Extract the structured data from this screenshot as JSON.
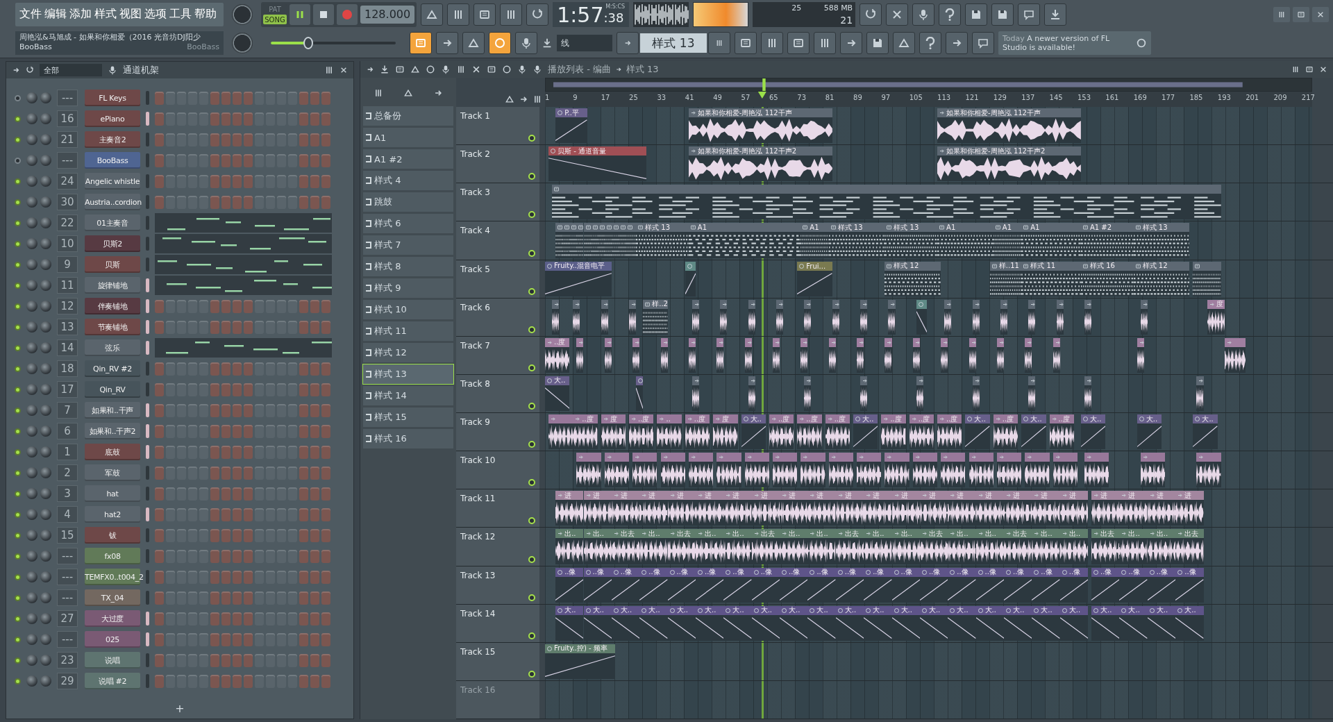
{
  "menu": [
    "文件",
    "编辑",
    "添加",
    "样式",
    "视图",
    "选项",
    "工具",
    "帮助"
  ],
  "hint": {
    "title": "周艳泓&马旭成 - 如果和你相爱（2016 光音坊DJ阳少",
    "line": "BooBass",
    "right": "BooBass"
  },
  "transport": {
    "modes": [
      {
        "label": "PAT",
        "selected": false
      },
      {
        "label": "SONG",
        "selected": true
      }
    ],
    "tempo": "128.000"
  },
  "time": {
    "main": "1:57",
    "cs": ":38",
    "unit": "M:S:CS"
  },
  "cpu": {
    "value": "25",
    "memory": "588 MB",
    "polyphony": "21"
  },
  "master_slider": {
    "level": 0.3
  },
  "tool_buttons": [
    {
      "on": true
    },
    {
      "on": false
    },
    {
      "on": false
    },
    {
      "on": true
    },
    {
      "on": false
    }
  ],
  "snap": "线",
  "pattern_selector": "样式 13",
  "news": {
    "when": "Today",
    "text": "A newer version of FL Studio is available!"
  },
  "channel_rack": {
    "filter": "全部",
    "title": "通道机架",
    "add": "+",
    "channels": [
      {
        "on": false,
        "route": "---",
        "name": "FL Keys",
        "color": "#6e4848",
        "selected": false,
        "kind": "steps"
      },
      {
        "on": true,
        "route": "16",
        "name": "ePiano",
        "color": "#6e4848",
        "selected": true,
        "kind": "steps"
      },
      {
        "on": true,
        "route": "21",
        "name": "主奏音2",
        "color": "#6e4848",
        "selected": false,
        "kind": "steps"
      },
      {
        "on": false,
        "route": "---",
        "name": "BooBass",
        "color": "#4f6592",
        "selected": false,
        "kind": "steps"
      },
      {
        "on": true,
        "route": "24",
        "name": "Angelic whistle",
        "color": "#5a646c",
        "selected": false,
        "kind": "steps"
      },
      {
        "on": true,
        "route": "30",
        "name": "Austria..cordion",
        "color": "#5a646c",
        "selected": false,
        "kind": "steps"
      },
      {
        "on": true,
        "route": "22",
        "name": "01主奏音",
        "color": "#5a646c",
        "selected": false,
        "kind": "pianoroll"
      },
      {
        "on": true,
        "route": "10",
        "name": "贝斯2",
        "color": "#573a42",
        "selected": false,
        "kind": "pianoroll"
      },
      {
        "on": true,
        "route": "9",
        "name": "贝斯",
        "color": "#6e4848",
        "selected": false,
        "kind": "pianoroll"
      },
      {
        "on": true,
        "route": "11",
        "name": "旋律铺地",
        "color": "#5a646c",
        "selected": true,
        "kind": "pianoroll"
      },
      {
        "on": true,
        "route": "12",
        "name": "伴奏铺地",
        "color": "#573a42",
        "selected": true,
        "kind": "steps"
      },
      {
        "on": true,
        "route": "13",
        "name": "节奏铺地",
        "color": "#6e4848",
        "selected": true,
        "kind": "steps"
      },
      {
        "on": true,
        "route": "14",
        "name": "弦乐",
        "color": "#5a646c",
        "selected": true,
        "kind": "pianoroll"
      },
      {
        "on": true,
        "route": "18",
        "name": "Qin_RV #2",
        "color": "#47545b",
        "selected": false,
        "kind": "steps"
      },
      {
        "on": true,
        "route": "17",
        "name": "Qin_RV",
        "color": "#47545b",
        "selected": false,
        "kind": "steps"
      },
      {
        "on": true,
        "route": "7",
        "name": "如果和..干声",
        "color": "#5a646c",
        "selected": true,
        "kind": "steps"
      },
      {
        "on": true,
        "route": "6",
        "name": "如果和..干声2",
        "color": "#5a646c",
        "selected": true,
        "kind": "steps"
      },
      {
        "on": true,
        "route": "1",
        "name": "底鼓",
        "color": "#6e4848",
        "selected": true,
        "kind": "steps"
      },
      {
        "on": true,
        "route": "2",
        "name": "军鼓",
        "color": "#5a646c",
        "selected": false,
        "kind": "steps"
      },
      {
        "on": true,
        "route": "3",
        "name": "hat",
        "color": "#5a646c",
        "selected": false,
        "kind": "steps"
      },
      {
        "on": true,
        "route": "4",
        "name": "hat2",
        "color": "#5a646c",
        "selected": true,
        "kind": "steps"
      },
      {
        "on": true,
        "route": "15",
        "name": "钹",
        "color": "#6e4848",
        "selected": false,
        "kind": "steps"
      },
      {
        "on": true,
        "route": "---",
        "name": "fx08",
        "color": "#617a58",
        "selected": false,
        "kind": "steps"
      },
      {
        "on": true,
        "route": "---",
        "name": "TEMFX0..t004_2",
        "color": "#617a58",
        "selected": false,
        "kind": "steps"
      },
      {
        "on": true,
        "route": "---",
        "name": "TX_04",
        "color": "#736860",
        "selected": false,
        "kind": "steps"
      },
      {
        "on": true,
        "route": "27",
        "name": "大过度",
        "color": "#7a5a74",
        "selected": true,
        "kind": "steps"
      },
      {
        "on": true,
        "route": "---",
        "name": "025",
        "color": "#7a5a74",
        "selected": true,
        "kind": "steps"
      },
      {
        "on": true,
        "route": "23",
        "name": "说唱",
        "color": "#5e7470",
        "selected": false,
        "kind": "steps"
      },
      {
        "on": true,
        "route": "29",
        "name": "说唱 #2",
        "color": "#5e7470",
        "selected": false,
        "kind": "steps"
      }
    ]
  },
  "playlist": {
    "breadcrumb": [
      "播放列表 - 编曲",
      "样式 13"
    ],
    "patterns": [
      {
        "name": "总备份",
        "selected": false
      },
      {
        "name": "A1",
        "selected": false
      },
      {
        "name": "A1 #2",
        "selected": false
      },
      {
        "name": "样式 4",
        "selected": false
      },
      {
        "name": "跳鼓",
        "selected": false
      },
      {
        "name": "样式 6",
        "selected": false
      },
      {
        "name": "样式 7",
        "selected": false
      },
      {
        "name": "样式 8",
        "selected": false
      },
      {
        "name": "样式 9",
        "selected": false
      },
      {
        "name": "样式 10",
        "selected": false
      },
      {
        "name": "样式 11",
        "selected": false
      },
      {
        "name": "样式 12",
        "selected": false
      },
      {
        "name": "样式 13",
        "selected": true
      },
      {
        "name": "样式 14",
        "selected": false
      },
      {
        "name": "样式 15",
        "selected": false
      },
      {
        "name": "样式 16",
        "selected": false
      }
    ],
    "ruler": [
      "1",
      "9",
      "17",
      "25",
      "33",
      "41",
      "49",
      "57",
      "65",
      "73",
      "81",
      "89",
      "97",
      "105",
      "113",
      "121",
      "129",
      "137",
      "145",
      "153",
      "161",
      "169",
      "177",
      "185",
      "193",
      "201",
      "209",
      "217"
    ],
    "tracks": [
      {
        "name": "Track 1",
        "disabled": false,
        "color": "#5d6873",
        "clips": [
          {
            "kind": "automation",
            "label": "P..平",
            "color": "#675f8a"
          },
          {
            "kind": "audio",
            "label": "如果和你相爱-周艳泓 112干声"
          },
          {
            "kind": "audio",
            "label": "如果和你相爱-周艳泓 112干声"
          }
        ]
      },
      {
        "name": "Track 2",
        "disabled": false,
        "color": "#5d6873",
        "clips": [
          {
            "kind": "automation",
            "label": "贝斯 - 通道音量",
            "color": "#a04f55"
          },
          {
            "kind": "audio",
            "label": "如果和你相爱-周艳泓 112干声2"
          },
          {
            "kind": "audio",
            "label": "如果和你相爱-周艳泓 112干声2"
          }
        ]
      },
      {
        "name": "Track 3",
        "disabled": false,
        "color": "#5d6873",
        "clips": [
          {
            "kind": "pattern"
          }
        ]
      },
      {
        "name": "Track 4",
        "disabled": false,
        "color": "#5d6873",
        "clips": [
          {
            "kind": "pattern"
          },
          {
            "kind": "pattern"
          },
          {
            "kind": "pattern"
          },
          {
            "kind": "pattern"
          },
          {
            "kind": "pattern"
          },
          {
            "kind": "pattern"
          },
          {
            "kind": "pattern"
          },
          {
            "kind": "pattern"
          },
          {
            "kind": "pattern"
          },
          {
            "kind": "pattern"
          },
          {
            "kind": "pattern"
          },
          {
            "kind": "pattern",
            "label": "样式 13"
          },
          {
            "kind": "pattern",
            "label": "A1"
          },
          {
            "kind": "pattern",
            "label": "A1"
          },
          {
            "kind": "pattern",
            "label": "样式 13"
          },
          {
            "kind": "pattern",
            "label": "样式 13"
          },
          {
            "kind": "pattern",
            "label": "A1"
          },
          {
            "kind": "pattern",
            "label": "A1"
          },
          {
            "kind": "pattern",
            "label": "A1"
          },
          {
            "kind": "pattern",
            "label": "A1 #2"
          },
          {
            "kind": "pattern",
            "label": "样式 13"
          }
        ]
      },
      {
        "name": "Track 5",
        "disabled": false,
        "color": "#5d6873",
        "clips": [
          {
            "kind": "automation",
            "label": "Fruity..混音电平",
            "color": "#5b5f8a"
          },
          {
            "kind": "automation",
            "color": "#5f8a86"
          },
          {
            "kind": "automation",
            "label": "Frui...",
            "color": "#7a7a50"
          },
          {
            "kind": "pattern",
            "label": "样式 12"
          },
          {
            "kind": "pattern",
            "label": "样..11"
          },
          {
            "kind": "pattern",
            "label": "样式 11"
          },
          {
            "kind": "pattern",
            "label": "样式 16"
          },
          {
            "kind": "pattern",
            "label": "样式 12"
          },
          {
            "kind": "pattern"
          }
        ]
      },
      {
        "name": "Track 6",
        "disabled": false,
        "color": "#5d6873",
        "clips": [
          {
            "kind": "audio"
          },
          {
            "kind": "audio"
          },
          {
            "kind": "audio"
          },
          {
            "kind": "audio"
          },
          {
            "kind": "pattern",
            "label": "样..2"
          },
          {
            "kind": "audio"
          },
          {
            "kind": "audio"
          },
          {
            "kind": "audio"
          },
          {
            "kind": "audio"
          },
          {
            "kind": "audio"
          },
          {
            "kind": "audio"
          },
          {
            "kind": "audio"
          },
          {
            "kind": "audio"
          },
          {
            "kind": "automation",
            "color": "#5f8a86"
          },
          {
            "kind": "audio"
          },
          {
            "kind": "audio"
          },
          {
            "kind": "audio"
          },
          {
            "kind": "audio"
          },
          {
            "kind": "audio"
          },
          {
            "kind": "audio"
          },
          {
            "kind": "audio"
          },
          {
            "kind": "audio",
            "label": "度",
            "color": "#a07ea0"
          }
        ]
      },
      {
        "name": "Track 7",
        "disabled": false,
        "color": "#a07ea0",
        "clips": [
          {
            "kind": "audio",
            "label": "..度"
          },
          {
            "kind": "audio"
          },
          {
            "kind": "audio"
          },
          {
            "kind": "audio"
          },
          {
            "kind": "audio"
          },
          {
            "kind": "audio"
          },
          {
            "kind": "audio"
          },
          {
            "kind": "audio"
          },
          {
            "kind": "audio"
          },
          {
            "kind": "audio"
          },
          {
            "kind": "audio"
          },
          {
            "kind": "audio"
          },
          {
            "kind": "audio"
          },
          {
            "kind": "audio"
          },
          {
            "kind": "audio"
          },
          {
            "kind": "audio"
          },
          {
            "kind": "audio"
          },
          {
            "kind": "audio"
          },
          {
            "kind": "audio"
          },
          {
            "kind": "audio"
          },
          {
            "kind": "audio"
          }
        ]
      },
      {
        "name": "Track 8",
        "disabled": false,
        "color": "#675f8a",
        "clips": [
          {
            "kind": "automation",
            "label": "大.."
          },
          {
            "kind": "automation"
          },
          {
            "kind": "audio",
            "color": "#5d6873"
          },
          {
            "kind": "audio",
            "color": "#5d6873"
          },
          {
            "kind": "audio",
            "color": "#5d6873"
          },
          {
            "kind": "audio",
            "color": "#5d6873"
          },
          {
            "kind": "audio",
            "color": "#5d6873"
          },
          {
            "kind": "audio",
            "color": "#5d6873"
          },
          {
            "kind": "audio",
            "color": "#5d6873"
          },
          {
            "kind": "audio",
            "color": "#5d6873"
          },
          {
            "kind": "audio",
            "color": "#5d6873"
          }
        ]
      },
      {
        "name": "Track 9",
        "disabled": false,
        "color": "#98789a",
        "clips": [
          {
            "kind": "audio"
          },
          {
            "kind": "audio",
            "label": "..度"
          },
          {
            "kind": "audio",
            "label": "度"
          },
          {
            "kind": "audio",
            "label": "..度"
          },
          {
            "kind": "audio",
            "label": ".."
          },
          {
            "kind": "audio",
            "label": "..度"
          },
          {
            "kind": "audio",
            "label": "度"
          },
          {
            "kind": "automation",
            "label": "大..",
            "color": "#675f8a"
          },
          {
            "kind": "audio",
            "label": "..度"
          },
          {
            "kind": "audio",
            "label": "..度"
          },
          {
            "kind": "audio",
            "label": "..度"
          },
          {
            "kind": "automation",
            "label": "大..",
            "color": "#675f8a"
          },
          {
            "kind": "audio",
            "label": "..度"
          },
          {
            "kind": "audio",
            "label": "..度"
          },
          {
            "kind": "audio",
            "label": "..度"
          },
          {
            "kind": "automation",
            "label": "大..",
            "color": "#675f8a"
          },
          {
            "kind": "audio",
            "label": "..度"
          },
          {
            "kind": "automation",
            "label": "大..",
            "color": "#675f8a"
          },
          {
            "kind": "audio",
            "label": "..度"
          },
          {
            "kind": "automation",
            "label": "大..",
            "color": "#675f8a"
          },
          {
            "kind": "automation",
            "label": "大..",
            "color": "#675f8a"
          },
          {
            "kind": "automation",
            "label": "大..",
            "color": "#675f8a"
          }
        ]
      },
      {
        "name": "Track 10",
        "disabled": false,
        "color": "#98789a",
        "clips": [
          {
            "kind": "audio"
          },
          {
            "kind": "audio"
          },
          {
            "kind": "audio"
          },
          {
            "kind": "audio"
          },
          {
            "kind": "audio"
          },
          {
            "kind": "audio"
          },
          {
            "kind": "audio"
          },
          {
            "kind": "audio"
          },
          {
            "kind": "audio"
          },
          {
            "kind": "audio"
          },
          {
            "kind": "audio"
          },
          {
            "kind": "audio"
          },
          {
            "kind": "audio"
          },
          {
            "kind": "audio"
          },
          {
            "kind": "audio"
          },
          {
            "kind": "audio"
          },
          {
            "kind": "audio"
          },
          {
            "kind": "audio"
          },
          {
            "kind": "audio"
          },
          {
            "kind": "audio"
          },
          {
            "kind": "audio"
          }
        ]
      },
      {
        "name": "Track 11",
        "disabled": false,
        "color": "#a3869f",
        "clips": [
          {
            "kind": "audio",
            "label": "进"
          },
          {
            "kind": "audio",
            "label": "进"
          },
          {
            "kind": "audio",
            "label": "进"
          },
          {
            "kind": "audio",
            "label": "进"
          },
          {
            "kind": "audio",
            "label": "进"
          },
          {
            "kind": "audio",
            "label": "进"
          },
          {
            "kind": "audio",
            "label": "进"
          },
          {
            "kind": "audio",
            "label": "进"
          },
          {
            "kind": "audio",
            "label": "进"
          },
          {
            "kind": "audio",
            "label": "进"
          },
          {
            "kind": "audio",
            "label": "进"
          },
          {
            "kind": "audio",
            "label": "进"
          },
          {
            "kind": "audio",
            "label": "进"
          },
          {
            "kind": "audio",
            "label": "进"
          },
          {
            "kind": "audio",
            "label": "进"
          },
          {
            "kind": "audio",
            "label": "进"
          },
          {
            "kind": "audio",
            "label": "进"
          },
          {
            "kind": "audio",
            "label": "进"
          },
          {
            "kind": "audio",
            "label": "进"
          },
          {
            "kind": "audio",
            "label": "进"
          },
          {
            "kind": "audio",
            "label": "进"
          },
          {
            "kind": "audio",
            "label": "进"
          },
          {
            "kind": "audio",
            "label": "进"
          }
        ]
      },
      {
        "name": "Track 12",
        "disabled": false,
        "color": "#5f7d6c",
        "clips": [
          {
            "kind": "audio",
            "label": "出.."
          },
          {
            "kind": "audio",
            "label": "出.."
          },
          {
            "kind": "audio",
            "label": "出去"
          },
          {
            "kind": "audio",
            "label": "出.."
          },
          {
            "kind": "audio",
            "label": "出去"
          },
          {
            "kind": "audio",
            "label": "出.."
          },
          {
            "kind": "audio",
            "label": "出.."
          },
          {
            "kind": "audio",
            "label": "出去"
          },
          {
            "kind": "audio",
            "label": "出.."
          },
          {
            "kind": "audio",
            "label": "出.."
          },
          {
            "kind": "audio",
            "label": "出去"
          },
          {
            "kind": "audio",
            "label": "出.."
          },
          {
            "kind": "audio",
            "label": "出.."
          },
          {
            "kind": "audio",
            "label": "出去"
          },
          {
            "kind": "audio",
            "label": "出.."
          },
          {
            "kind": "audio",
            "label": "出.."
          },
          {
            "kind": "audio",
            "label": "出去"
          },
          {
            "kind": "audio",
            "label": "出.."
          },
          {
            "kind": "audio",
            "label": "出.."
          },
          {
            "kind": "audio",
            "label": "出去"
          },
          {
            "kind": "audio",
            "label": "出.."
          },
          {
            "kind": "audio",
            "label": "出.."
          },
          {
            "kind": "audio",
            "label": "出去"
          }
        ]
      },
      {
        "name": "Track 13",
        "disabled": false,
        "color": "#5e5489",
        "clips": [
          {
            "kind": "automation",
            "label": "..像"
          },
          {
            "kind": "automation",
            "label": "..像"
          },
          {
            "kind": "automation",
            "label": "..像"
          },
          {
            "kind": "automation",
            "label": "..像"
          },
          {
            "kind": "automation",
            "label": "..像"
          },
          {
            "kind": "automation",
            "label": "..像"
          },
          {
            "kind": "automation",
            "label": "..像"
          },
          {
            "kind": "automation",
            "label": "..像"
          },
          {
            "kind": "automation",
            "label": "..像"
          },
          {
            "kind": "automation",
            "label": "..像"
          },
          {
            "kind": "automation",
            "label": "..像"
          },
          {
            "kind": "automation",
            "label": "..像"
          },
          {
            "kind": "automation",
            "label": "..像"
          },
          {
            "kind": "automation",
            "label": "..像"
          },
          {
            "kind": "automation",
            "label": "..像"
          },
          {
            "kind": "automation",
            "label": "..像"
          },
          {
            "kind": "automation",
            "label": "..像"
          },
          {
            "kind": "automation",
            "label": "..像"
          },
          {
            "kind": "automation",
            "label": "..像"
          },
          {
            "kind": "automation",
            "label": "..像"
          },
          {
            "kind": "automation",
            "label": "..像"
          },
          {
            "kind": "automation",
            "label": "..像"
          },
          {
            "kind": "automation",
            "label": "..像"
          }
        ]
      },
      {
        "name": "Track 14",
        "disabled": false,
        "color": "#5e5489",
        "clips": [
          {
            "kind": "automation",
            "label": "大.."
          },
          {
            "kind": "automation",
            "label": "大.."
          },
          {
            "kind": "automation",
            "label": "大.."
          },
          {
            "kind": "automation",
            "label": "大.."
          },
          {
            "kind": "automation",
            "label": "大.."
          },
          {
            "kind": "automation",
            "label": "大.."
          },
          {
            "kind": "automation",
            "label": "大.."
          },
          {
            "kind": "automation",
            "label": "大.."
          },
          {
            "kind": "automation",
            "label": "大.."
          },
          {
            "kind": "automation",
            "label": "大.."
          },
          {
            "kind": "automation",
            "label": "大.."
          },
          {
            "kind": "automation",
            "label": "大.."
          },
          {
            "kind": "automation",
            "label": "大.."
          },
          {
            "kind": "automation",
            "label": "大.."
          },
          {
            "kind": "automation",
            "label": "大.."
          },
          {
            "kind": "automation",
            "label": "大.."
          },
          {
            "kind": "automation",
            "label": "大.."
          },
          {
            "kind": "automation",
            "label": "大.."
          },
          {
            "kind": "automation",
            "label": "大.."
          },
          {
            "kind": "automation",
            "label": "大.."
          },
          {
            "kind": "automation",
            "label": "大.."
          },
          {
            "kind": "automation",
            "label": "大.."
          },
          {
            "kind": "automation",
            "label": "大.."
          }
        ]
      },
      {
        "name": "Track 15",
        "disabled": false,
        "color": "#5f7d6c",
        "clips": [
          {
            "kind": "automation",
            "label": "Fruity..控) - 频率"
          }
        ]
      },
      {
        "name": "Track 16",
        "disabled": true
      }
    ]
  }
}
